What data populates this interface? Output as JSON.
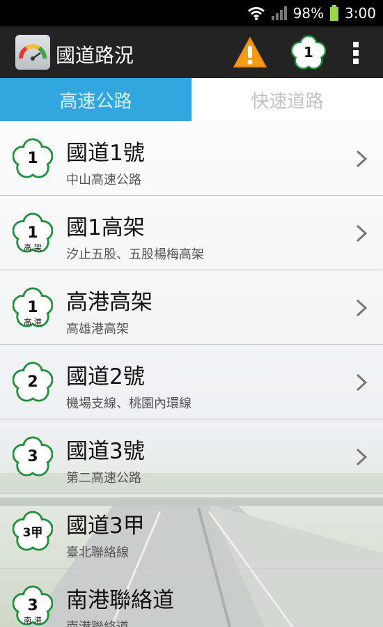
{
  "status_bar": {
    "battery": "98%",
    "time": "3:00"
  },
  "app_bar": {
    "title": "國道路況",
    "highway_badge": "1"
  },
  "tabs": [
    {
      "label": "高速公路",
      "selected": true
    },
    {
      "label": "快速道路",
      "selected": false
    }
  ],
  "routes": [
    {
      "title": "國道1號",
      "subtitle": "中山高速公路",
      "badge": "1",
      "badge_sub": ""
    },
    {
      "title": "國1高架",
      "subtitle": "汐止五股、五股楊梅高架",
      "badge": "1",
      "badge_sub": "高 架"
    },
    {
      "title": "高港高架",
      "subtitle": "高雄港高架",
      "badge": "1",
      "badge_sub": "高 港"
    },
    {
      "title": "國道2號",
      "subtitle": "機場支線、桃園內環線",
      "badge": "2",
      "badge_sub": ""
    },
    {
      "title": "國道3號",
      "subtitle": "第二高速公路",
      "badge": "3",
      "badge_sub": ""
    },
    {
      "title": "國道3甲",
      "subtitle": "臺北聯絡線",
      "badge": "3甲",
      "badge_sub": ""
    },
    {
      "title": "南港聯絡道",
      "subtitle": "南港聯絡道",
      "badge": "3",
      "badge_sub": "南 港"
    }
  ],
  "colors": {
    "tab_active": "#32a6de",
    "app_bar": "#232323",
    "badge_green": "#1f8f3a",
    "warning": "#f39c12"
  }
}
